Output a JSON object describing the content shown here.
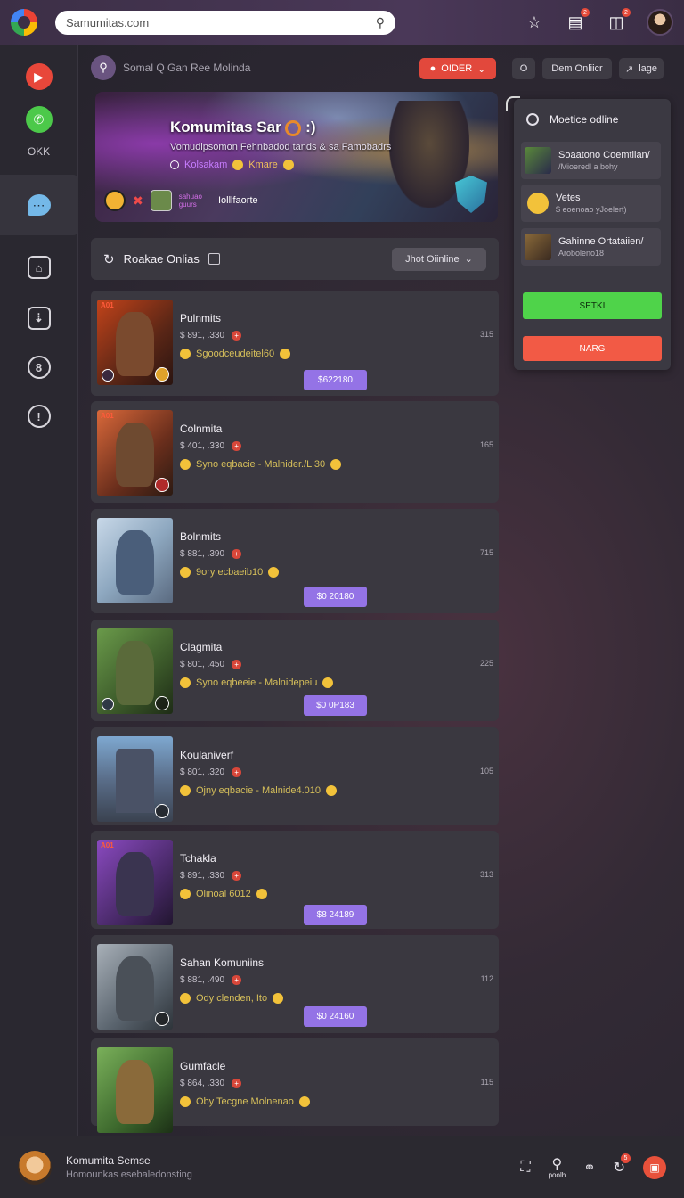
{
  "colors": {
    "accent_purple": "#9473e6",
    "accent_red": "#e2483c",
    "accent_green": "#4fd34a",
    "bg": "#2a2630"
  },
  "topbar": {
    "search_value": "Samumitas.com",
    "icons": [
      "google-logo",
      "search-icon",
      "star-icon",
      "bar-chart-icon",
      "download-icon",
      "avatar"
    ],
    "badge_1": "2",
    "badge_2": "2"
  },
  "sidebar": {
    "items": [
      {
        "icon": "play-icon"
      },
      {
        "icon": "phone-icon",
        "label": "OKK"
      },
      {
        "icon": "chat-icon"
      },
      {
        "icon": "home-icon"
      },
      {
        "icon": "inbox-icon"
      },
      {
        "icon": "discord-icon"
      },
      {
        "icon": "clock-icon"
      }
    ]
  },
  "header": {
    "title": "Somal Q Gan Ree Molinda",
    "order_label": "OIDER",
    "o_label": "O",
    "dem_label": "Dem Onliicr",
    "lage_label": "lage"
  },
  "hero": {
    "title": "Komumitas Sar",
    "title_suffix": ":)",
    "subtitle": "Vomudipsomon  Fehnbadod tands  & sa Famobadrs",
    "tag_a": "Kolsakam",
    "tag_b": "Kmare",
    "small_tag": "sahuao\nguurs",
    "bottom_label": "Iolllfaorte"
  },
  "section": {
    "title": "Roakae Onlias",
    "select_label": "Jhot Oiinline"
  },
  "cards": [
    {
      "title": "Pulnmits",
      "meta": "$ 891, .330",
      "desc": "Sgoodceudeitel60",
      "num": "315",
      "button": "$622180",
      "badge": "A01"
    },
    {
      "title": "Colnmita",
      "meta": "$ 401, .330",
      "desc": "Syno eqbacie - Malnider./L 30",
      "num": "165",
      "button": "",
      "badge": "A01"
    },
    {
      "title": "Bolnmits",
      "meta": "$ 881, .390",
      "desc": "9ory ecbaeib10",
      "num": "715",
      "button": "$0 20180",
      "badge": ""
    },
    {
      "title": "Clagmita",
      "meta": "$ 801, .450",
      "desc": "Syno eqbeeie - Malnidepeiu",
      "num": "225",
      "button": "$0 0P183",
      "badge": ""
    },
    {
      "title": "Koulaniverf",
      "meta": "$ 801, .320",
      "desc": "Ojny eqbacie - Malnide4.010",
      "num": "105",
      "button": "",
      "badge": ""
    },
    {
      "title": "Tchakla",
      "meta": "$ 891, .330",
      "desc": "Olinoal 6012",
      "num": "313",
      "button": "$8 24189",
      "badge": "A01"
    },
    {
      "title": "Sahan Komuniins",
      "meta": "$ 881, .490",
      "desc": "Ody clenden, Ito",
      "num": "112",
      "button": "$0 24160",
      "badge": ""
    },
    {
      "title": "Gumfacle",
      "meta": "$ 864, .330",
      "desc": "Oby Tecgne Molnenao",
      "num": "115",
      "button": "",
      "badge": ""
    }
  ],
  "right_panel": {
    "title": "Moetice odline",
    "items": [
      {
        "name": "Soaatono Coemtilan/",
        "sub": "/Mioeredl a bohy"
      },
      {
        "name": "Vetes",
        "sub": "$ eoenoao yJoelert)"
      },
      {
        "name": "Gahinne Ortataiien/",
        "sub": "Aroboleno18"
      }
    ],
    "green_button": "SETKI",
    "red_button": "NARG"
  },
  "bottombar": {
    "user_name": "Komumita Semse",
    "user_sub": "Homounkas esebaledonsting",
    "icon_label": "poolh",
    "badge": "5"
  }
}
